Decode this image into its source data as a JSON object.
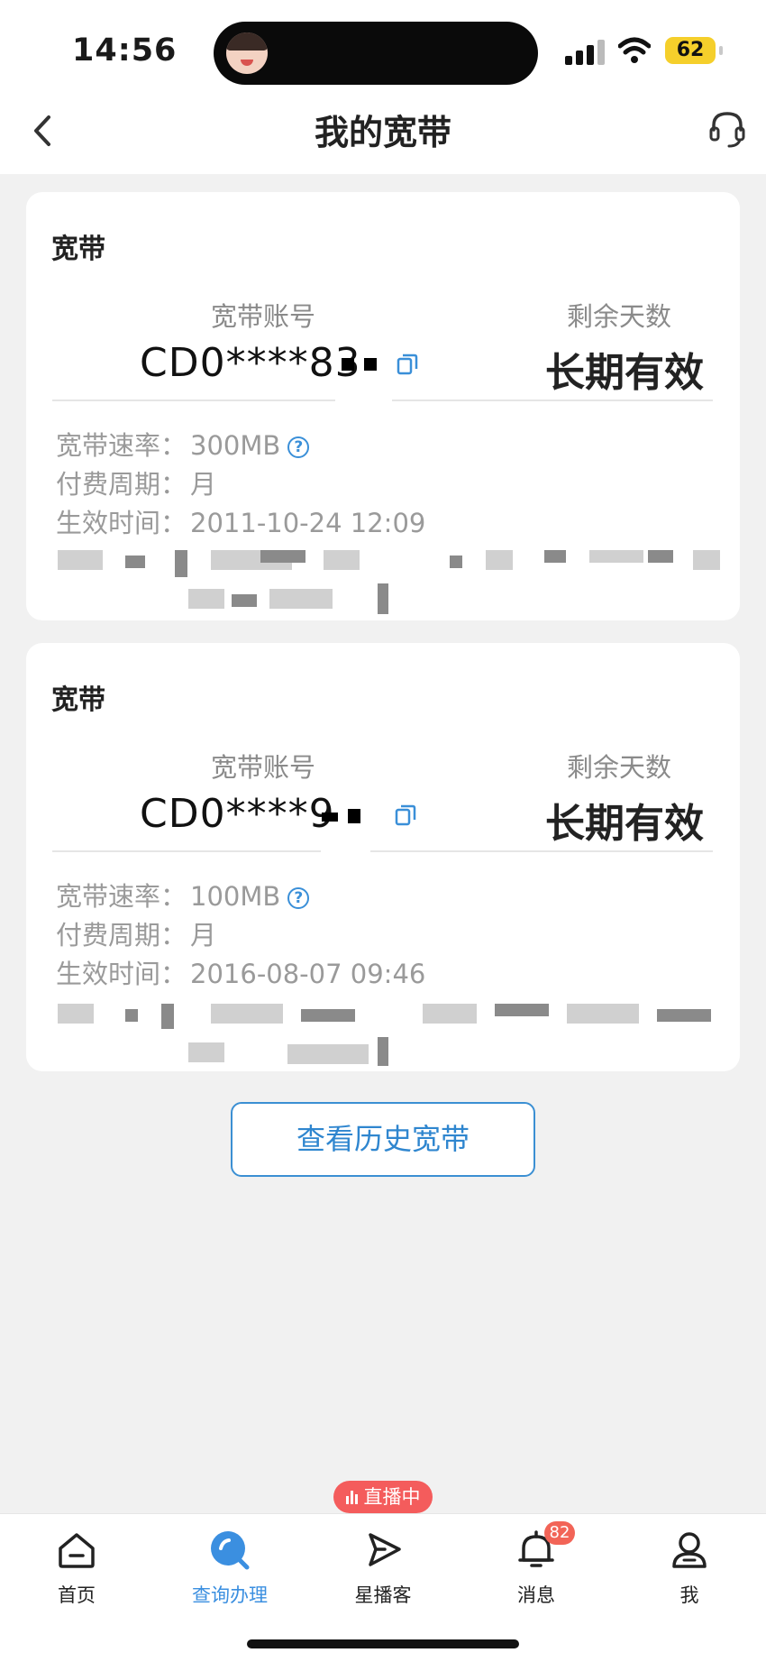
{
  "status_bar": {
    "time": "14:56",
    "battery_level": "62",
    "battery_color": "#f5cf2b"
  },
  "header": {
    "title": "我的宽带",
    "back_icon": "chevron-left-icon",
    "service_icon": "headset-icon"
  },
  "cards": [
    {
      "title": "宽带",
      "account_label": "宽带账号",
      "account_value": "CD0****83",
      "days_label": "剩余天数",
      "days_value": "长期有效",
      "speed_label": "宽带速率：",
      "speed_value": "300MB",
      "cycle_label": "付费周期：",
      "cycle_value": "月",
      "effective_label": "生效时间：",
      "effective_value": "2011-10-24 12:09"
    },
    {
      "title": "宽带",
      "account_label": "宽带账号",
      "account_value": "CD0****9",
      "days_label": "剩余天数",
      "days_value": "长期有效",
      "speed_label": "宽带速率：",
      "speed_value": "100MB",
      "cycle_label": "付费周期：",
      "cycle_value": "月",
      "effective_label": "生效时间：",
      "effective_value": "2016-08-07 09:46"
    }
  ],
  "history_button": "查看历史宽带",
  "live_badge": "直播中",
  "tabs": [
    {
      "label": "首页",
      "icon": "home-icon",
      "active": false
    },
    {
      "label": "查询办理",
      "icon": "search-icon",
      "active": true
    },
    {
      "label": "星播客",
      "icon": "play-icon",
      "active": false
    },
    {
      "label": "消息",
      "icon": "bell-icon",
      "active": false,
      "badge": "82"
    },
    {
      "label": "我",
      "icon": "user-icon",
      "active": false
    }
  ],
  "colors": {
    "accent": "#3b8fe0",
    "badge_red": "#f26457",
    "background": "#f1f1f1"
  }
}
